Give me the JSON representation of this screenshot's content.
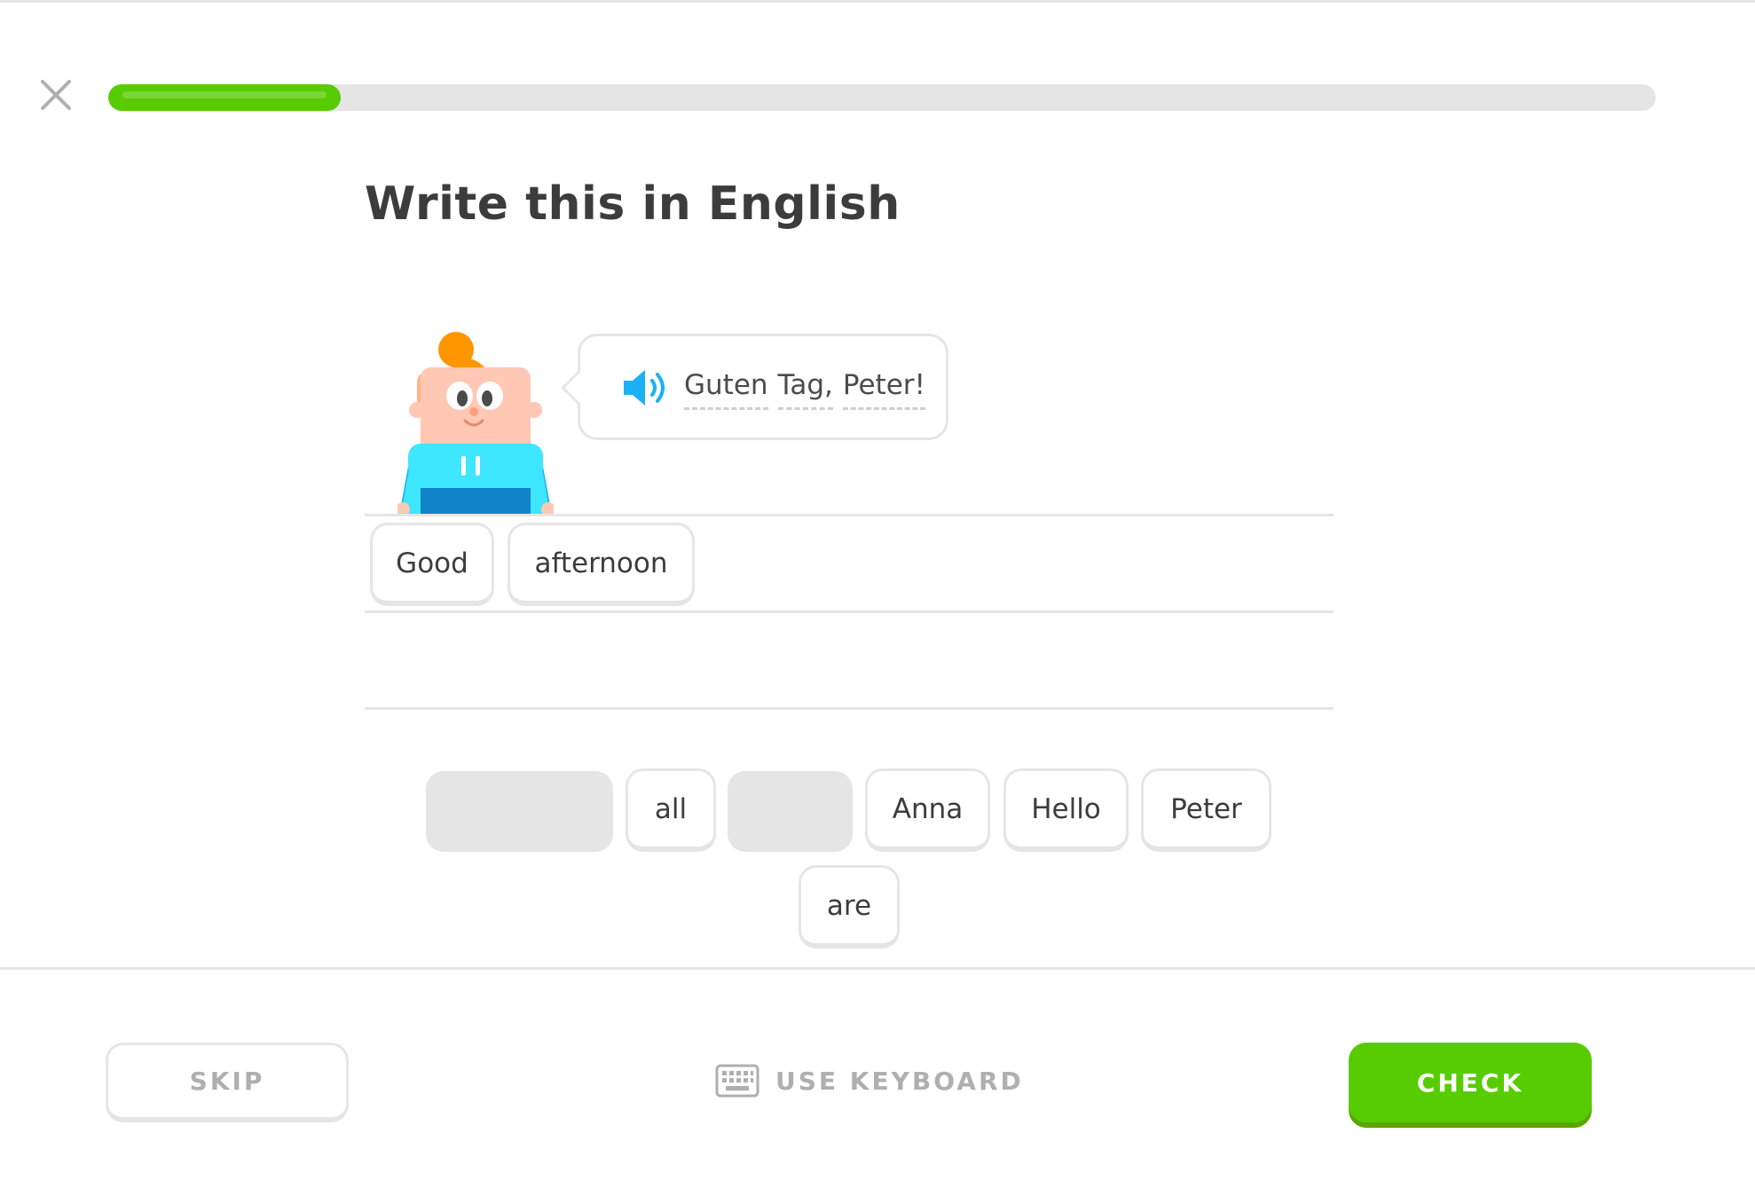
{
  "lesson": {
    "progress_percent": 15,
    "close_icon": "close-icon"
  },
  "header": {
    "title": "Write this in English"
  },
  "prompt": {
    "speaker_icon": "speaker-icon",
    "words": [
      "Guten",
      "Tag,",
      "Peter!"
    ]
  },
  "answer": {
    "selected_words": [
      "Good",
      "afternoon"
    ]
  },
  "word_bank": {
    "row1": [
      "",
      "all",
      "",
      "Anna",
      "Hello",
      "Peter"
    ],
    "row2": [
      "are"
    ]
  },
  "footer": {
    "skip_label": "SKIP",
    "keyboard_label": "USE KEYBOARD",
    "keyboard_icon": "keyboard-icon",
    "check_label": "CHECK"
  },
  "colors": {
    "accent_green": "#58cc02",
    "accent_green_dark": "#58a700",
    "speaker_blue": "#1cb0f6",
    "border_gray": "#e5e5e5",
    "muted_text": "#afafaf"
  }
}
